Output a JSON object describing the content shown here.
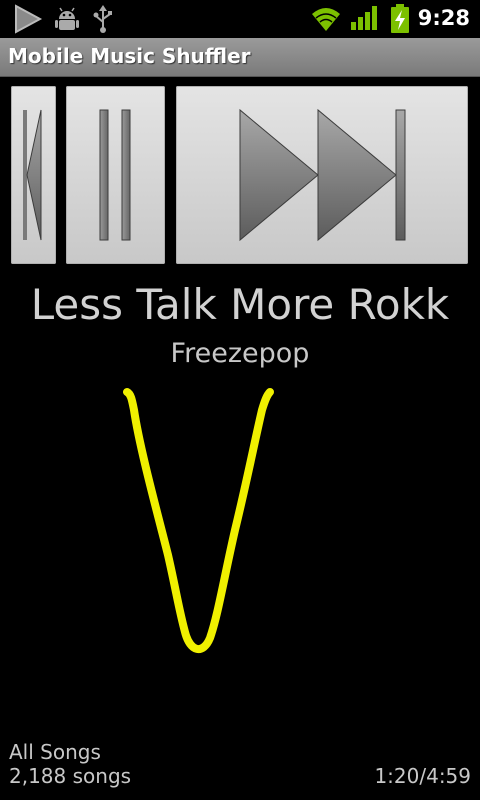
{
  "status_bar": {
    "time": "9:28",
    "icons": [
      "play-notification-icon",
      "android-debug-icon",
      "usb-icon",
      "wifi-icon",
      "signal-icon",
      "battery-charging-icon"
    ],
    "colors": {
      "wifi": "#7cc000",
      "signal": "#7cc000",
      "battery": "#7cc000",
      "notification": "#9a9a9a"
    }
  },
  "app": {
    "title": "Mobile Music Shuffler"
  },
  "controls": {
    "buttons": [
      "previous-button",
      "pause-button",
      "next-button"
    ]
  },
  "now_playing": {
    "title": "Less Talk More Rokk",
    "artist": "Freezepop"
  },
  "gesture": {
    "shape": "V",
    "color": "#f0f000"
  },
  "footer": {
    "playlist": "All Songs",
    "song_count": "2,188 songs",
    "time": "1:20/4:59"
  }
}
